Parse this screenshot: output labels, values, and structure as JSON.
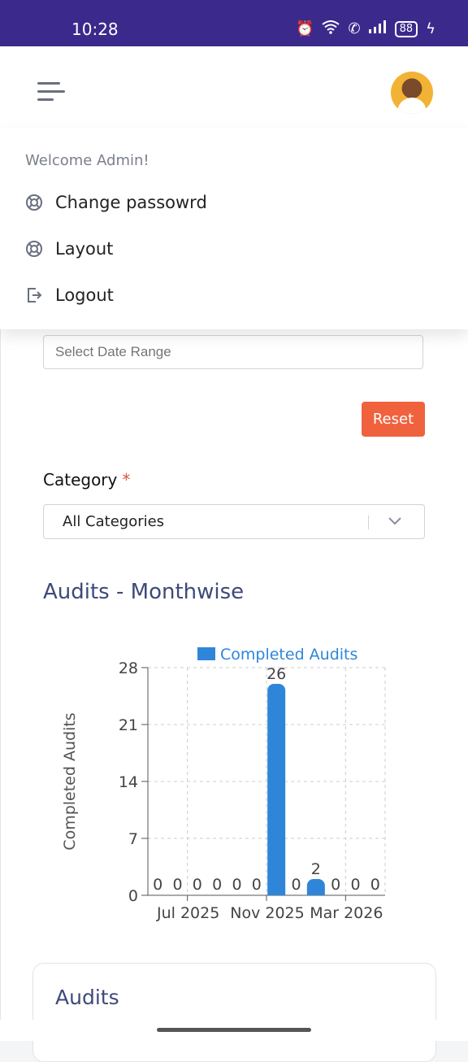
{
  "status_bar": {
    "time": "10:28",
    "battery": "88"
  },
  "header": {
    "menu_icon": "hamburger-icon",
    "avatar": "user-avatar"
  },
  "dropdown": {
    "welcome": "Welcome Admin!",
    "items": [
      {
        "label": "Change passowrd",
        "icon": "lifebuoy-icon"
      },
      {
        "label": "Layout",
        "icon": "lifebuoy-icon"
      },
      {
        "label": "Logout",
        "icon": "logout-icon"
      }
    ]
  },
  "filters": {
    "date_placeholder": "Select Date Range",
    "reset_label": "Reset",
    "category_label": "Category",
    "required_mark": "*",
    "category_value": "All Categories"
  },
  "chart_section": {
    "title": "Audits - Monthwise"
  },
  "chart_data": {
    "type": "bar",
    "series": [
      {
        "name": "Completed Audits",
        "values": [
          0,
          0,
          0,
          0,
          0,
          0,
          26,
          0,
          2,
          0,
          0,
          0
        ]
      }
    ],
    "x_tick_labels": [
      "Jul 2025",
      "Nov 2025",
      "Mar 2026"
    ],
    "y_ticks": [
      0,
      7,
      14,
      21,
      28
    ],
    "ylim": [
      0,
      28
    ],
    "ylabel": "Completed Audits",
    "xlabel": "",
    "grid": true,
    "legend": "top",
    "color": "#2f86d8"
  },
  "audits_card": {
    "title": "Audits"
  }
}
